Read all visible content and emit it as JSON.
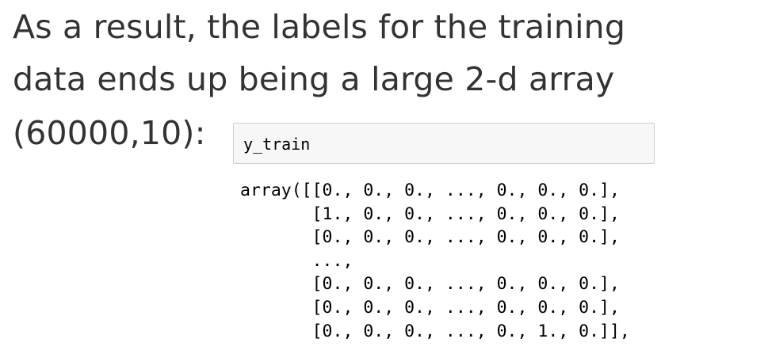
{
  "caption": {
    "line1": "As a result, the labels for the training",
    "line2": "data ends up being a large 2-d array",
    "line3": "(60000,10):"
  },
  "code_cell": {
    "input": "y_train"
  },
  "output": {
    "lines": [
      "array([[0., 0., 0., ..., 0., 0., 0.],",
      "       [1., 0., 0., ..., 0., 0., 0.],",
      "       [0., 0., 0., ..., 0., 0., 0.],",
      "       ...,",
      "       [0., 0., 0., ..., 0., 0., 0.],",
      "       [0., 0., 0., ..., 0., 0., 0.],",
      "       [0., 0., 0., ..., 0., 1., 0.]],"
    ]
  }
}
